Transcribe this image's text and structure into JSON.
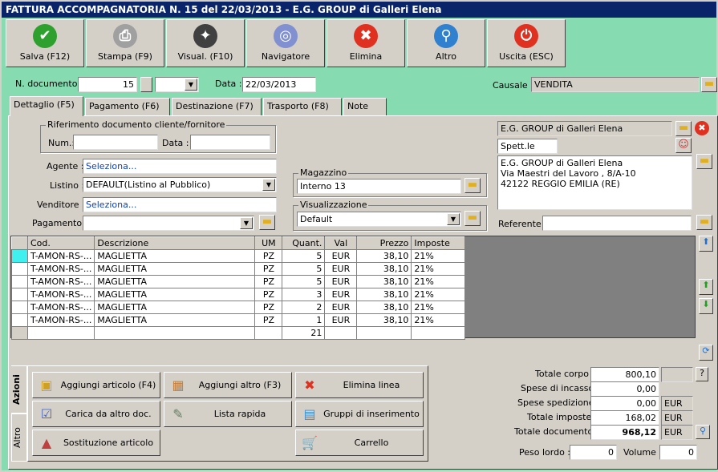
{
  "window": {
    "title": "FATTURA ACCOMPAGNATORIA N. 15 del 22/03/2013 - E.G. GROUP di Galleri Elena"
  },
  "toolbar": [
    {
      "label": "Salva (F12)",
      "icon": "check-icon",
      "color": "#2ea02e",
      "glyph": "✔"
    },
    {
      "label": "Stampa (F9)",
      "icon": "printer-icon",
      "color": "#a0a0a0",
      "glyph": "⎙"
    },
    {
      "label": "Visual. (F10)",
      "icon": "magic-wand-icon",
      "color": "#404040",
      "glyph": "✦"
    },
    {
      "label": "Navigatore",
      "icon": "compass-icon",
      "color": "#8090d0",
      "glyph": "◎"
    },
    {
      "label": "Elimina",
      "icon": "delete-x-icon",
      "color": "#e03020",
      "glyph": "✖"
    },
    {
      "label": "Altro",
      "icon": "search-icon",
      "color": "#3080d0",
      "glyph": "⚲"
    },
    {
      "label": "Uscita (ESC)",
      "icon": "power-icon",
      "color": "#e03020",
      "glyph": "⏻"
    }
  ],
  "header": {
    "ndoc_label": "N. documento :",
    "ndoc": "15",
    "data_label": "Data :",
    "data": "22/03/2013",
    "causale_label": "Causale :",
    "causale": "VENDITA"
  },
  "tabs": [
    "Dettaglio (F5)",
    "Pagamento (F6)",
    "Destinazione (F7)",
    "Trasporto (F8)",
    "Note"
  ],
  "rif": {
    "title": "Riferimento documento cliente/fornitore",
    "num_label": "Num.:",
    "data_label": "Data :",
    "num": "",
    "data": ""
  },
  "form": {
    "agente_label": "Agente :",
    "agente": "Seleziona...",
    "listino_label": "Listino :",
    "listino": "DEFAULT(Listino al Pubblico)",
    "venditore_label": "Venditore :",
    "venditore": "Seleziona...",
    "pagamento_label": "Pagamento :",
    "pagamento": ""
  },
  "magazzino": {
    "title": "Magazzino",
    "value": "Interno 13"
  },
  "visualizzazione": {
    "title": "Visualizzazione",
    "value": "Default"
  },
  "cliente": {
    "name": "E.G. GROUP di Galleri Elena",
    "spett": "Spett.le",
    "address": [
      "E.G. GROUP di Galleri Elena",
      "Via Maestri del Lavoro , 8/A-10",
      "42122 REGGIO EMILIA (RE)"
    ],
    "referente_label": "Referente",
    "referente": ""
  },
  "grid": {
    "columns": [
      "Cod.",
      "Descrizione",
      "UM",
      "Quant.",
      "Val",
      "Prezzo",
      "Imposte"
    ],
    "rows": [
      [
        "T-AMON-RS-...",
        "MAGLIETTA",
        "PZ",
        "5",
        "EUR",
        "38,10",
        "21%"
      ],
      [
        "T-AMON-RS-...",
        "MAGLIETTA",
        "PZ",
        "5",
        "EUR",
        "38,10",
        "21%"
      ],
      [
        "T-AMON-RS-...",
        "MAGLIETTA",
        "PZ",
        "5",
        "EUR",
        "38,10",
        "21%"
      ],
      [
        "T-AMON-RS-...",
        "MAGLIETTA",
        "PZ",
        "3",
        "EUR",
        "38,10",
        "21%"
      ],
      [
        "T-AMON-RS-...",
        "MAGLIETTA",
        "PZ",
        "2",
        "EUR",
        "38,10",
        "21%"
      ],
      [
        "T-AMON-RS-...",
        "MAGLIETTA",
        "PZ",
        "1",
        "EUR",
        "38,10",
        "21%"
      ]
    ],
    "total_qty": "21"
  },
  "side_tabs": [
    "Azioni",
    "Altro"
  ],
  "actions": [
    {
      "label": "Aggiungi articolo (F4)",
      "glyph": "▣",
      "color": "#d0a020"
    },
    {
      "label": "Aggiungi altro (F3)",
      "glyph": "▦",
      "color": "#c08040"
    },
    {
      "label": "Elimina linea",
      "glyph": "✖",
      "color": "#e03020"
    },
    {
      "label": "Carica da altro doc.",
      "glyph": "☑",
      "color": "#4060c0"
    },
    {
      "label": "Lista rapida",
      "glyph": "✎",
      "color": "#608060"
    },
    {
      "label": "Gruppi di inserimento",
      "glyph": "▤",
      "color": "#4090d0"
    },
    {
      "label": "Sostituzione articolo",
      "glyph": "▲",
      "color": "#c04040"
    },
    {
      "label": "",
      "glyph": "",
      "color": "#d4d0c8"
    },
    {
      "label": "Carrello",
      "glyph": "🛒",
      "color": "#808080"
    }
  ],
  "totals": {
    "corpo_label": "Totale corpo :",
    "corpo": "800,10",
    "incasso_label": "Spese di incasso :",
    "incasso": "0,00",
    "spedizione_label": "Spese spedizione :",
    "spedizione": "0,00",
    "imposte_label": "Totale imposte :",
    "imposte": "168,02",
    "documento_label": "Totale documento :",
    "documento": "968,12",
    "currency": "EUR",
    "help": "?",
    "peso_label": "Peso lordo :",
    "peso": "0",
    "volume_label": "Volume :",
    "volume": "0"
  }
}
